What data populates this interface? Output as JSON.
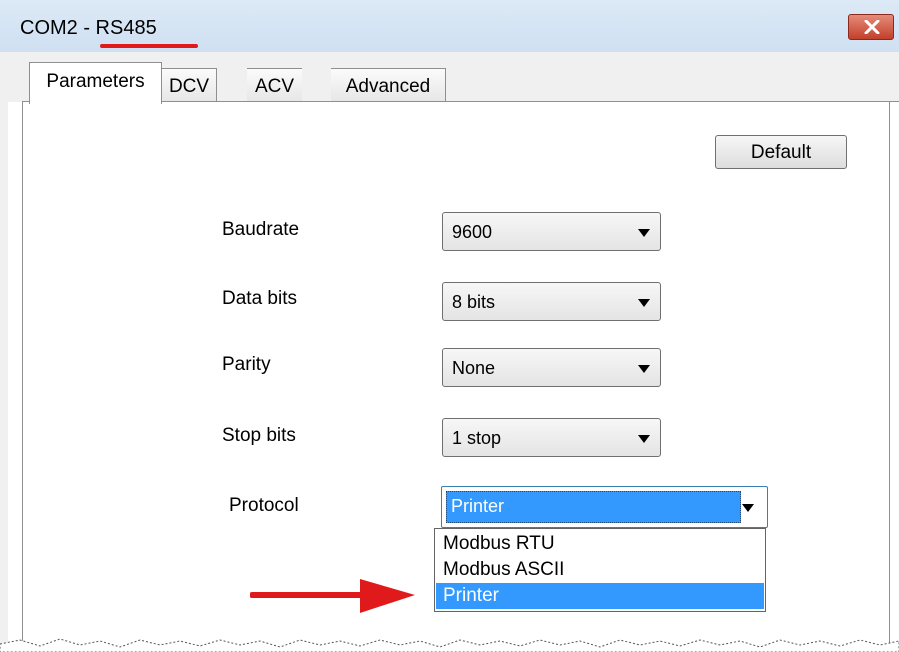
{
  "window": {
    "title": "COM2 - RS485",
    "close_icon": "close-icon",
    "annotation_color": "#e01a1a"
  },
  "tabs": [
    {
      "label": "Parameters",
      "active": true
    },
    {
      "label": "DCV",
      "active": false
    },
    {
      "label": "ACV",
      "active": false
    },
    {
      "label": "Advanced",
      "active": false
    }
  ],
  "buttons": {
    "default_label": "Default"
  },
  "fields": {
    "baudrate": {
      "label": "Baudrate",
      "value": "9600"
    },
    "data_bits": {
      "label": "Data bits",
      "value": "8 bits"
    },
    "parity": {
      "label": "Parity",
      "value": "None"
    },
    "stop_bits": {
      "label": "Stop bits",
      "value": "1 stop"
    },
    "protocol": {
      "label": "Protocol",
      "value": "Printer",
      "options": [
        "Modbus RTU",
        "Modbus ASCII",
        "Printer"
      ],
      "selected_index": 2
    }
  },
  "colors": {
    "selection": "#3399ff",
    "arrow": "#e01a1a"
  }
}
